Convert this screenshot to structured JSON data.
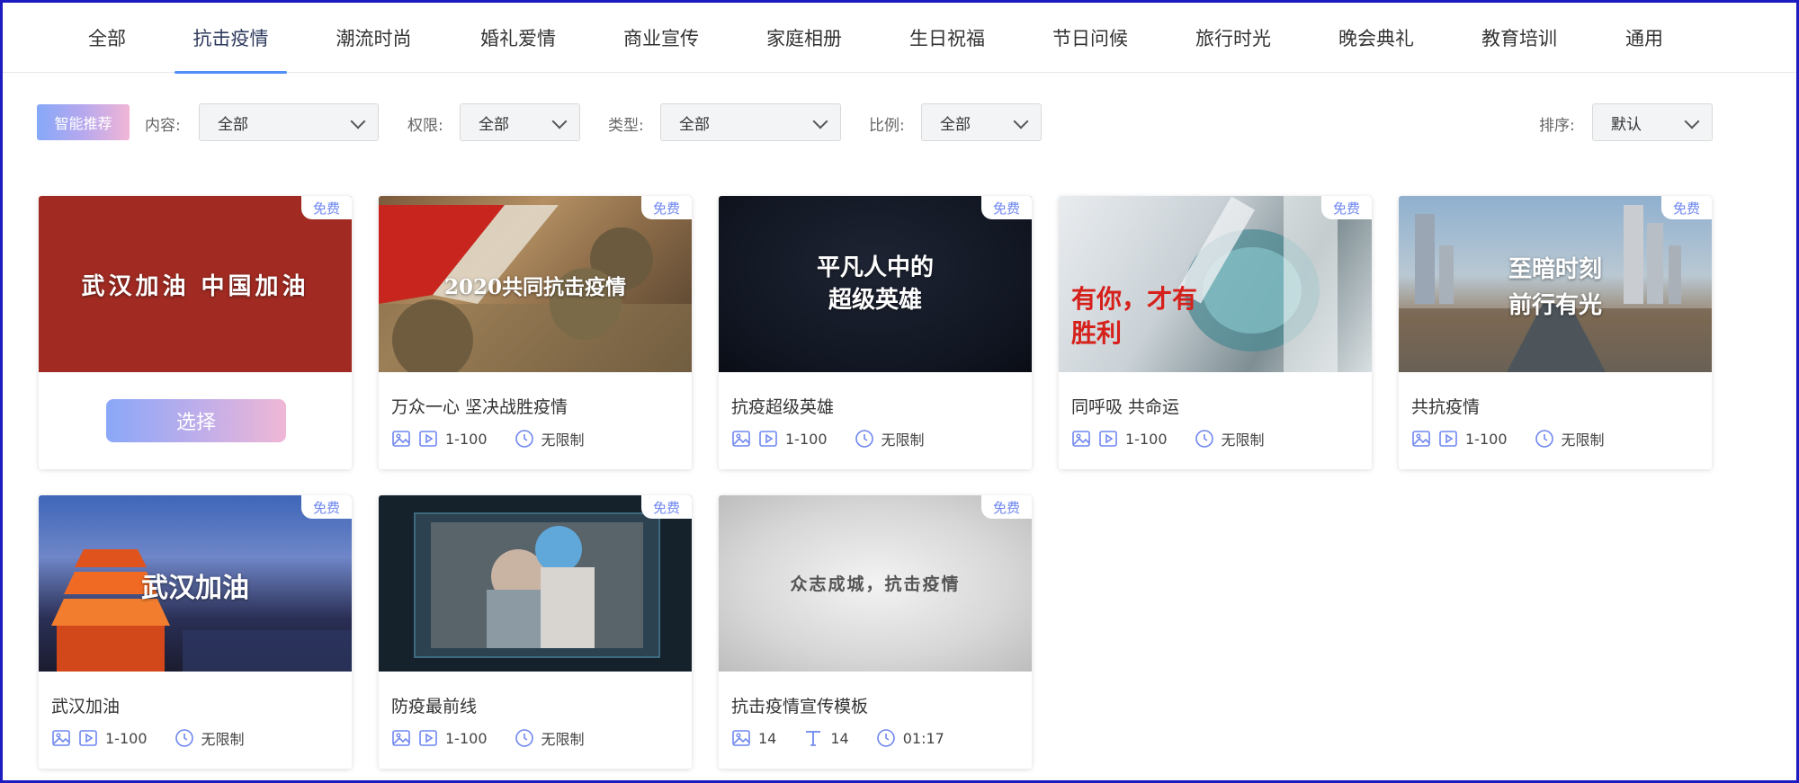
{
  "nav": {
    "tabs": [
      "全部",
      "抗击疫情",
      "潮流时尚",
      "婚礼爱情",
      "商业宣传",
      "家庭相册",
      "生日祝福",
      "节日问候",
      "旅行时光",
      "晚会典礼",
      "教育培训",
      "通用"
    ],
    "active_index": 1
  },
  "filters": {
    "smart_label": "智能推荐",
    "content_label": "内容:",
    "content_value": "全部",
    "permission_label": "权限:",
    "permission_value": "全部",
    "type_label": "类型:",
    "type_value": "全部",
    "ratio_label": "比例:",
    "ratio_value": "全部",
    "sort_label": "排序:",
    "sort_value": "默认"
  },
  "colors": {
    "accent": "#4f8ff7",
    "badge": "#6f87f0",
    "border": "#1c1cc0"
  },
  "badge_label": "免费",
  "select_label": "选择",
  "cards": [
    {
      "thumb_text": "武汉加油 中国加油",
      "hovered": true
    },
    {
      "title": "万众一心 坚决战胜疫情",
      "thumb_text": "2020共同抗击疫情",
      "range": "1-100",
      "duration": "无限制"
    },
    {
      "title": "抗疫超级英雄",
      "thumb_text": "平凡人中的 超级英雄",
      "range": "1-100",
      "duration": "无限制"
    },
    {
      "title": "同呼吸 共命运",
      "thumb_text": "有你，才有胜利",
      "range": "1-100",
      "duration": "无限制"
    },
    {
      "title": "共抗疫情",
      "thumb_text": "至暗时刻 前行有光",
      "range": "1-100",
      "duration": "无限制"
    },
    {
      "title": "武汉加油",
      "thumb_text": "武汉加油",
      "range": "1-100",
      "duration": "无限制"
    },
    {
      "title": "防疫最前线",
      "range": "1-100",
      "duration": "无限制"
    },
    {
      "title": "抗击疫情宣传模板",
      "thumb_text": "众志成城，抗击疫情",
      "images": "14",
      "texts": "14",
      "duration": "01:17"
    }
  ]
}
